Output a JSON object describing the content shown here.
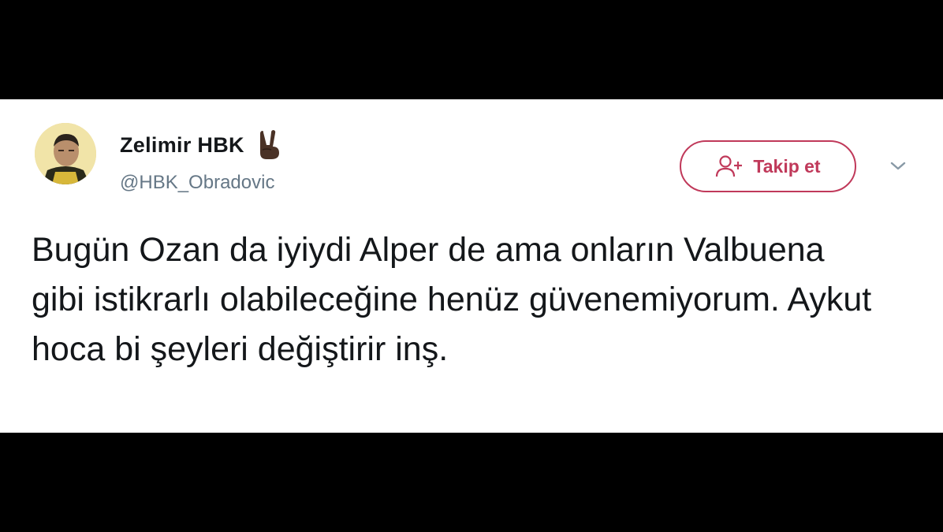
{
  "tweet": {
    "display_name": "Zelimir HBK",
    "handle": "@HBK_Obradovic",
    "follow_button_label": "Takip et",
    "text": "Bugün Ozan da iyiydi Alper de ama onların Valbuena gibi istikrarlı olabileceğine henüz güvenemiyorum. Aykut hoca bi şeyleri değiştirir inş.",
    "icons": {
      "avatar": "profile-avatar",
      "name_emoji": "victory-hand-icon",
      "follow": "add-user-icon",
      "menu": "chevron-down-icon"
    }
  },
  "colors": {
    "follow_accent": "#c0395a",
    "text_primary": "#14171a",
    "text_secondary": "#657786",
    "letterbox": "#000000",
    "card_background": "#ffffff"
  }
}
